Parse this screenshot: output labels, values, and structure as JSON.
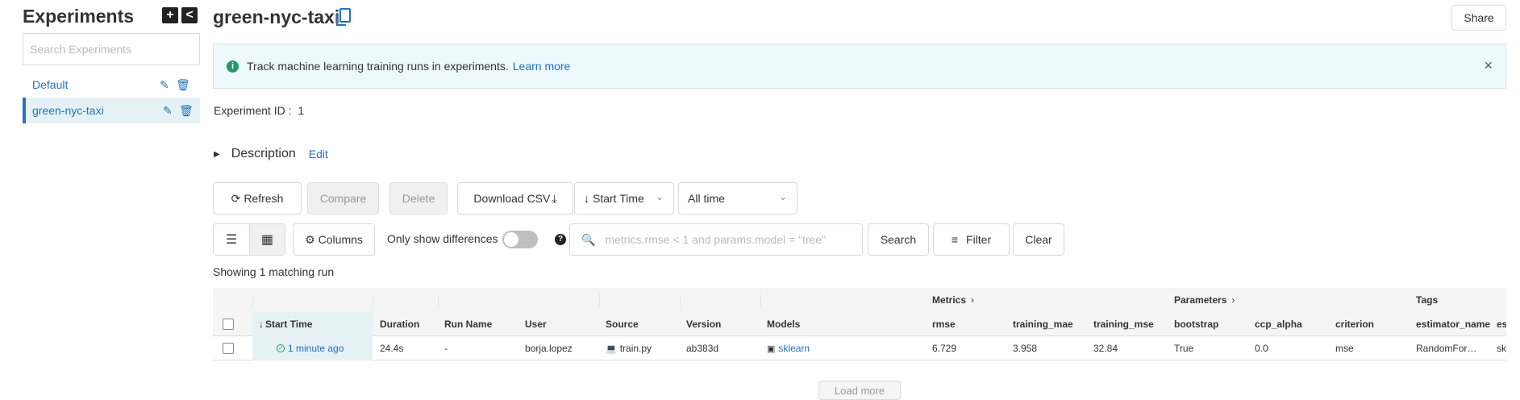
{
  "sidebar": {
    "title": "Experiments",
    "add_symbol": "+",
    "collapse_symbol": "<",
    "search_placeholder": "Search Experiments",
    "items": [
      {
        "label": "Default",
        "active": false
      },
      {
        "label": "green-nyc-taxi",
        "active": true
      }
    ]
  },
  "header": {
    "title": "green-nyc-taxi",
    "share_label": "Share"
  },
  "banner": {
    "text": "Track machine learning training runs in experiments.",
    "link": "Learn more",
    "close": "×"
  },
  "experiment_id": {
    "label": "Experiment ID :",
    "value": "1"
  },
  "description": {
    "label": "Description",
    "edit_label": "Edit"
  },
  "toolbar": {
    "refresh": "Refresh",
    "compare": "Compare",
    "delete": "Delete",
    "download_csv": "Download CSV",
    "sort": "Start Time",
    "time_range": "All time",
    "columns": "Columns",
    "only_show_differences": "Only show differences",
    "search_placeholder": "metrics.rmse < 1 and params.model = \"tree\"",
    "search": "Search",
    "filter": "Filter",
    "clear": "Clear"
  },
  "showing_text": "Showing 1 matching run",
  "table": {
    "groups": {
      "metrics": "Metrics",
      "parameters": "Parameters",
      "tags": "Tags"
    },
    "columns": [
      "Start Time",
      "Duration",
      "Run Name",
      "User",
      "Source",
      "Version",
      "Models",
      "rmse",
      "training_mae",
      "training_mse",
      "bootstrap",
      "ccp_alpha",
      "criterion",
      "estimator_name",
      "es"
    ],
    "rows": [
      {
        "start_time": "1 minute ago",
        "duration": "24.4s",
        "run_name": "-",
        "user": "borja.lopez",
        "source": "train.py",
        "version": "ab383d",
        "models": "sklearn",
        "rmse": "6.729",
        "training_mae": "3.958",
        "training_mse": "32.84",
        "bootstrap": "True",
        "ccp_alpha": "0.0",
        "criterion": "mse",
        "estimator_name": "RandomFor…",
        "es": "sk"
      }
    ]
  },
  "load_more": "Load more"
}
